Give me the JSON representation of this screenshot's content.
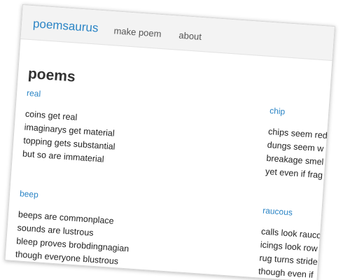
{
  "navbar": {
    "brand": "poemsaurus",
    "links": [
      "make poem",
      "about"
    ]
  },
  "page_title": "poems",
  "poems": [
    {
      "title": "real",
      "lines": [
        "coins get real",
        "imaginarys get material",
        "topping gets substantial",
        "but so are immaterial"
      ]
    },
    {
      "title": "chip",
      "lines": [
        "chips seem red",
        "dungs seem w",
        "breakage smel",
        "yet even if frag"
      ]
    },
    {
      "title": "beep",
      "lines": [
        "beeps are commonplace",
        "sounds are lustrous",
        "bleep proves brobdingnagian",
        "though everyone blustrous"
      ]
    },
    {
      "title": "raucous",
      "lines": [
        "calls look rauco",
        "icings look row",
        "rug turns stride",
        "though even if"
      ]
    }
  ],
  "colors": {
    "link": "#2a84c5",
    "navbar_bg": "#f3f3f3",
    "text": "#222222"
  }
}
